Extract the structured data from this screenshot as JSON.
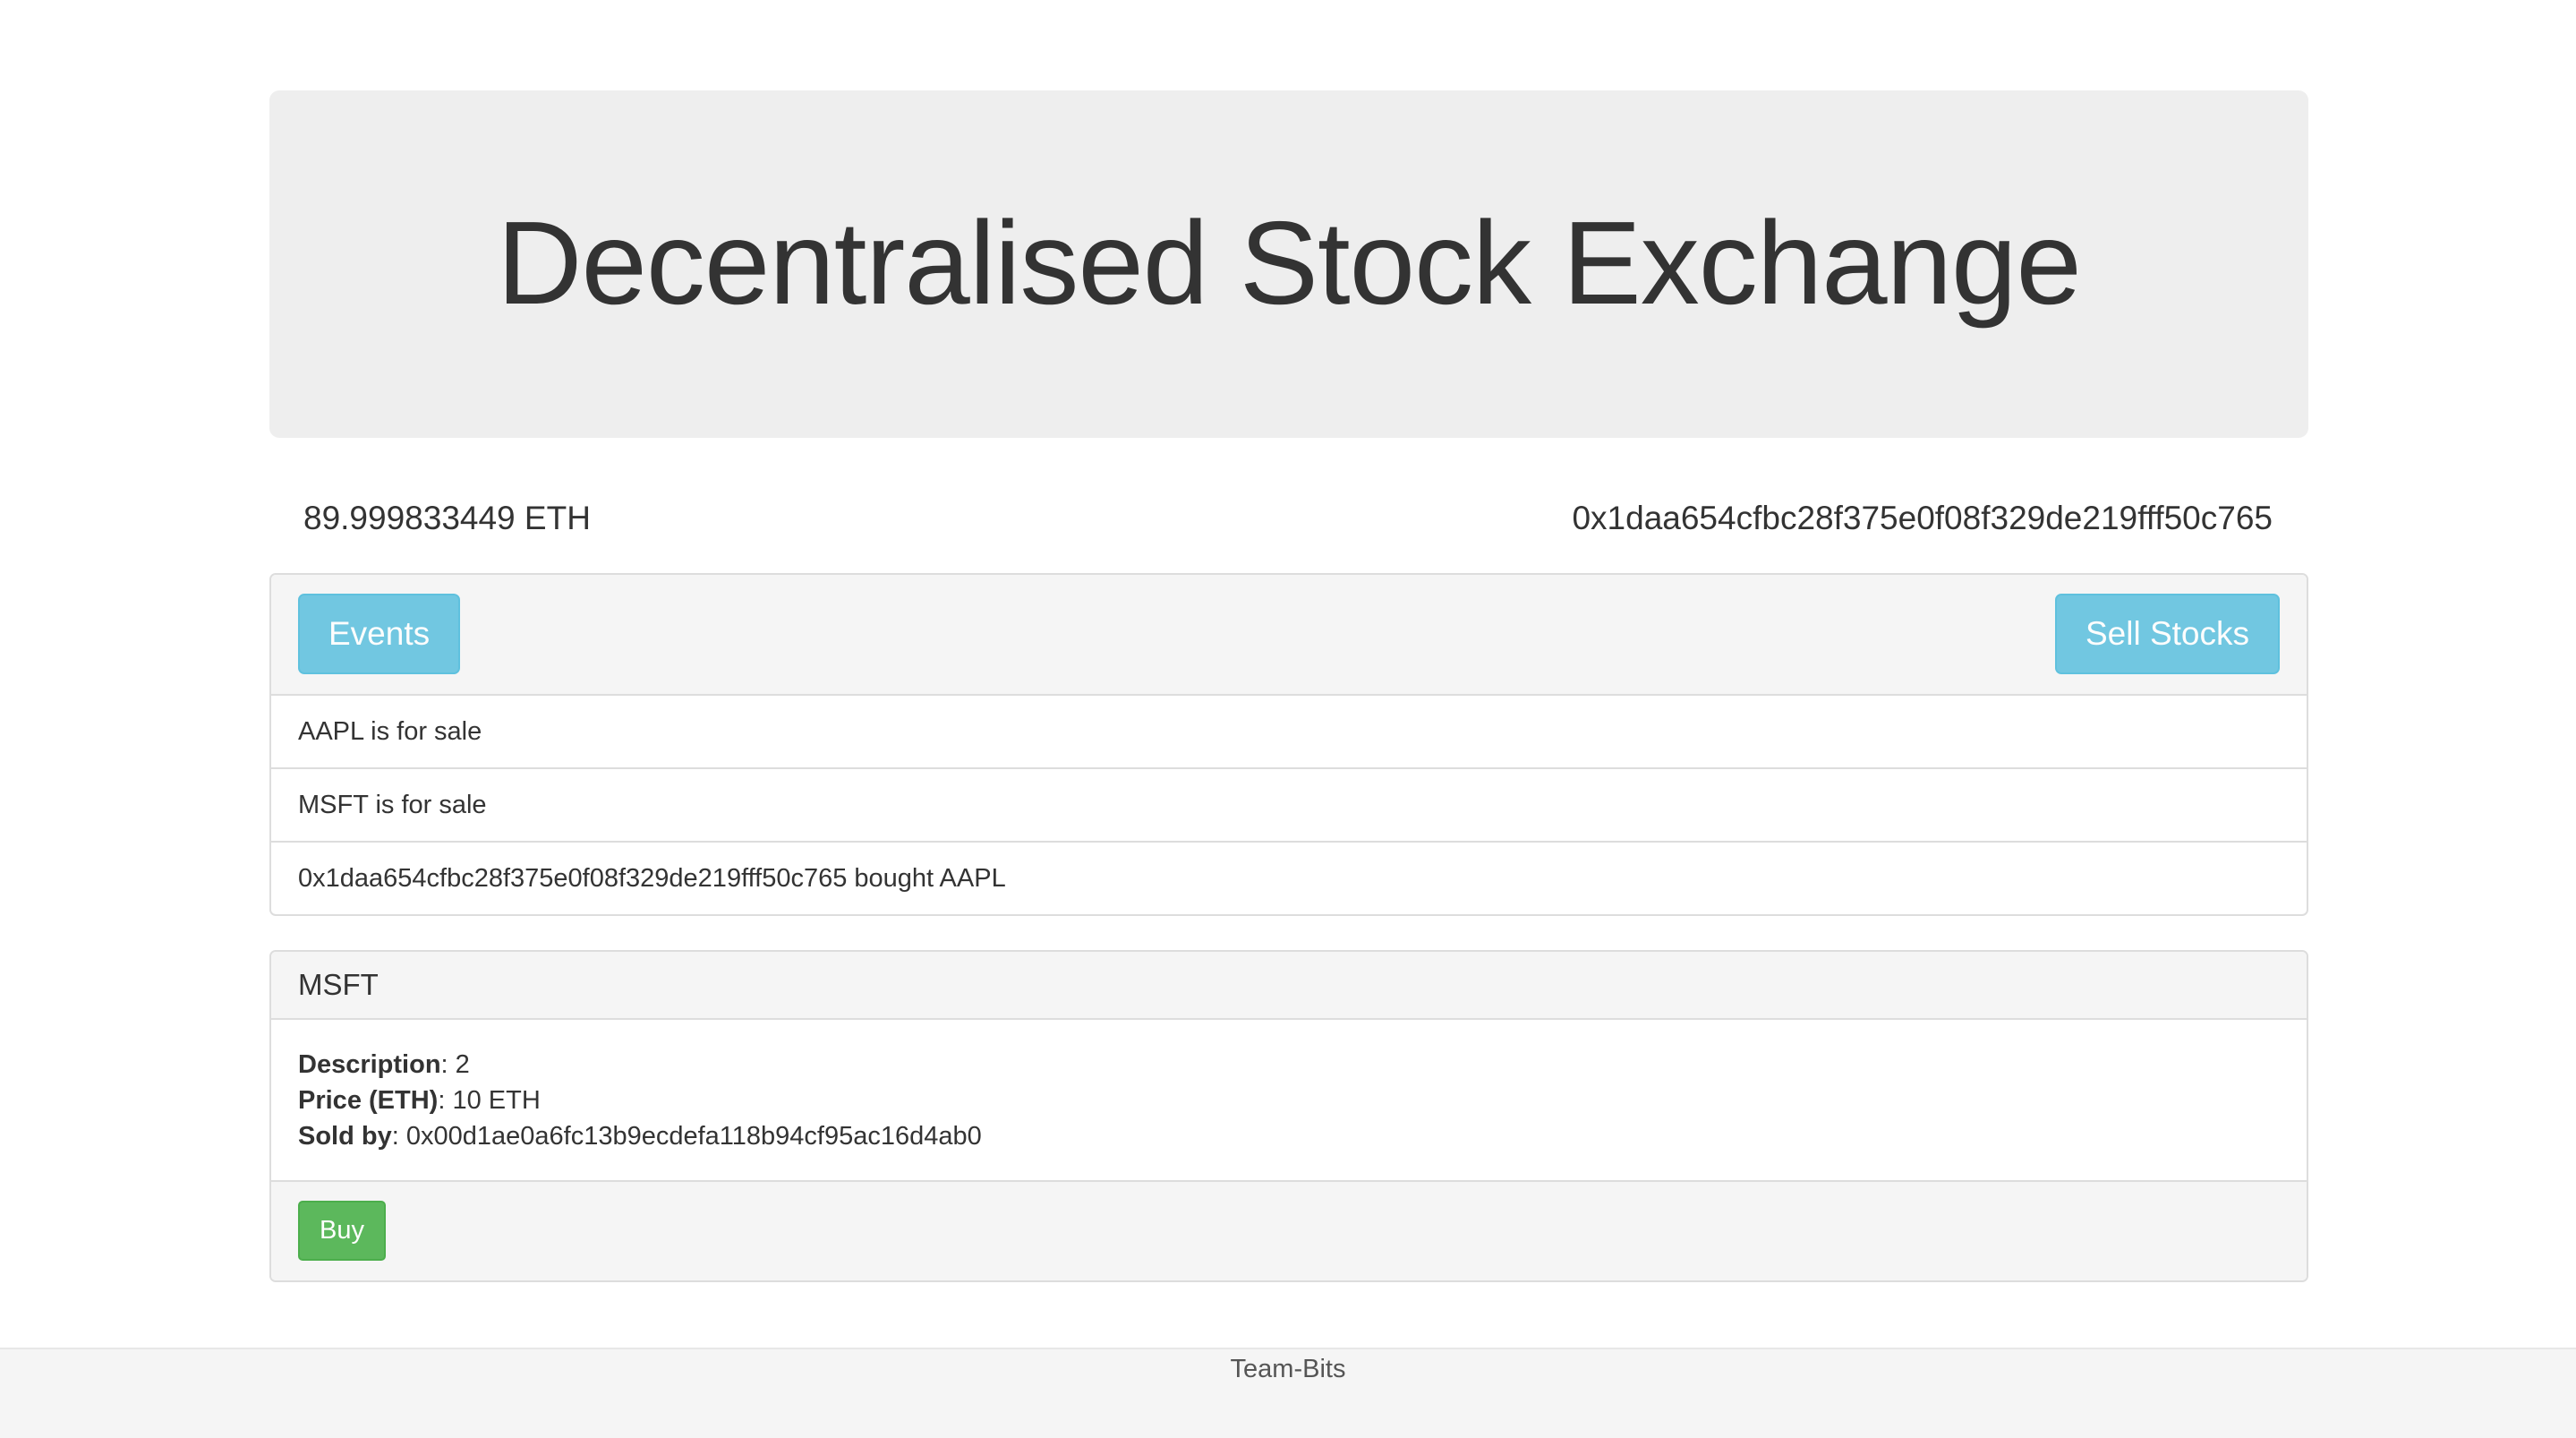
{
  "header": {
    "title": "Decentralised Stock Exchange"
  },
  "account": {
    "balance": "89.999833449 ETH",
    "address": "0x1daa654cfbc28f375e0f08f329de219fff50c765"
  },
  "events_panel": {
    "events_button": "Events",
    "sell_button": "Sell Stocks",
    "events": [
      "AAPL is for sale",
      "MSFT is for sale",
      "0x1daa654cfbc28f375e0f08f329de219fff50c765 bought AAPL"
    ]
  },
  "stock": {
    "symbol": "MSFT",
    "description_label": "Description",
    "description_value": ": 2",
    "price_label": "Price (ETH)",
    "price_value": ": 10 ETH",
    "seller_label": "Sold by",
    "seller_value": ": 0x00d1ae0a6fc13b9ecdefa118b94cf95ac16d4ab0",
    "buy_button": "Buy"
  },
  "footer": {
    "text": "Team-Bits"
  },
  "colors": {
    "info": "#5bc0de",
    "success": "#5cb85c",
    "jumbotron": "#eeeeee"
  }
}
